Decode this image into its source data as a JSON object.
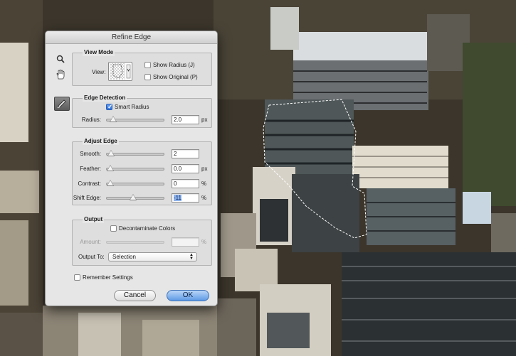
{
  "dialog": {
    "title": "Refine Edge",
    "cancel_label": "Cancel",
    "ok_label": "OK"
  },
  "tools": {
    "zoom_icon": "zoom-icon",
    "hand_icon": "hand-icon",
    "refine_icon": "refine-radius-icon"
  },
  "view_mode": {
    "title": "View Mode",
    "view_label": "View:",
    "show_radius": "Show Radius (J)",
    "show_radius_checked": false,
    "show_original": "Show Original (P)",
    "show_original_checked": false
  },
  "edge_detection": {
    "title": "Edge Detection",
    "smart_radius": "Smart Radius",
    "smart_radius_checked": true,
    "radius_label": "Radius:",
    "radius_value": "2.0",
    "radius_unit": "px",
    "radius_level": 0.05
  },
  "adjust_edge": {
    "title": "Adjust Edge",
    "smooth_label": "Smooth:",
    "smooth_value": "2",
    "smooth_level": 0.02,
    "feather_label": "Feather:",
    "feather_value": "0.0",
    "feather_unit": "px",
    "feather_level": 0.0,
    "contrast_label": "Contrast:",
    "contrast_value": "0",
    "contrast_unit": "%",
    "contrast_level": 0.0,
    "shift_label": "Shift Edge:",
    "shift_value": "-11",
    "shift_unit": "%",
    "shift_level": 0.45
  },
  "output": {
    "title": "Output",
    "decontaminate": "Decontaminate Colors",
    "decontaminate_checked": false,
    "amount_label": "Amount:",
    "amount_value": "",
    "amount_unit": "%",
    "output_to_label": "Output To:",
    "output_to_value": "Selection"
  },
  "remember_settings": "Remember Settings",
  "remember_checked": false
}
